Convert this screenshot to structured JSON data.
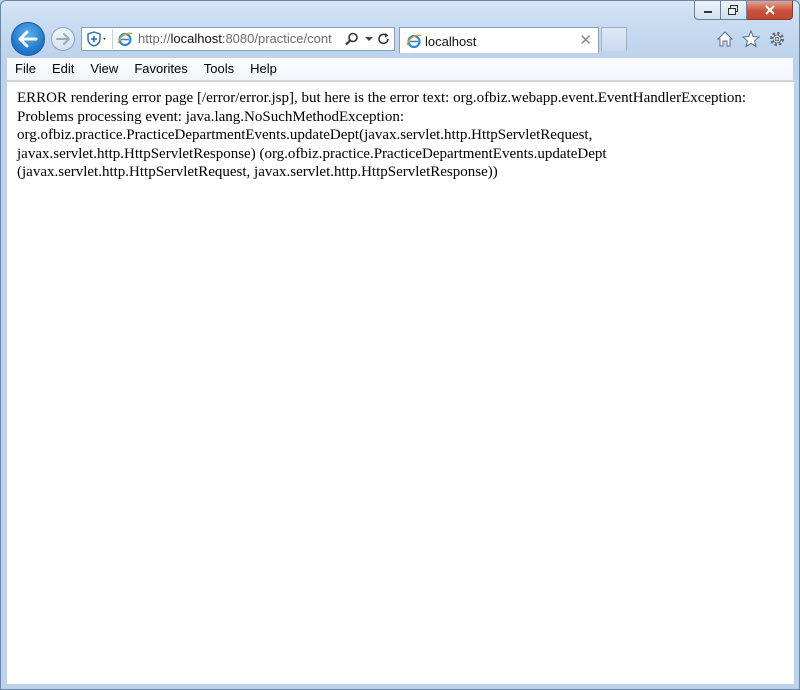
{
  "browser": {
    "address_prefix": "http://",
    "address_host": "localhost",
    "address_rest": ":8080/practice/cont",
    "tab_title": "localhost",
    "menu": [
      "File",
      "Edit",
      "View",
      "Favorites",
      "Tools",
      "Help"
    ]
  },
  "page": {
    "error_text": "ERROR rendering error page [/error/error.jsp], but here is the error text: org.ofbiz.webapp.event.EventHandlerException: Problems processing event: java.lang.NoSuchMethodException: org.ofbiz.practice.PracticeDepartmentEvents.updateDept(javax.servlet.http.HttpServletRequest, javax.servlet.http.HttpServletResponse) (org.ofbiz.practice.PracticeDepartmentEvents.updateDept (javax.servlet.http.HttpServletRequest, javax.servlet.http.HttpServletResponse))"
  },
  "icons": {
    "back": "back-arrow-icon",
    "forward": "forward-arrow-icon",
    "close_tab": "close-icon",
    "home": "home-icon",
    "favorites": "star-icon",
    "tools": "gear-icon"
  },
  "colors": {
    "frame": "#bdd2ec",
    "back_button": "#1f72c4",
    "close_button": "#c7503b"
  }
}
